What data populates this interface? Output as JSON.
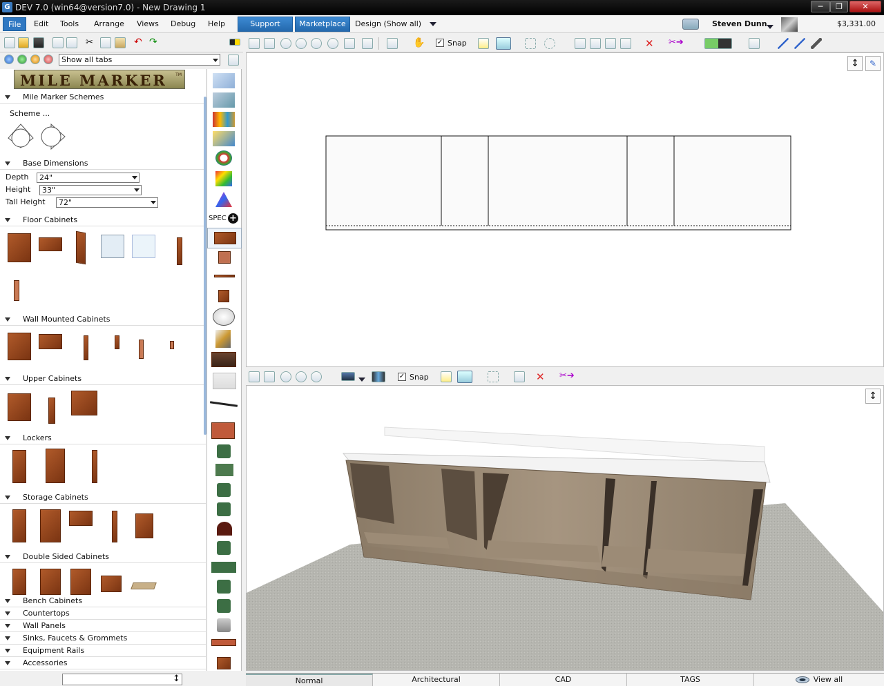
{
  "window": {
    "title": "DEV 7.0 (win64@version7.0) - New Drawing 1",
    "controls": [
      "─",
      "❐",
      "✕"
    ]
  },
  "menubar": {
    "items": [
      "File",
      "Edit",
      "Tools",
      "Arrange",
      "Views",
      "Debug",
      "Help"
    ],
    "support_label": "Support",
    "marketplace_label": "Marketplace",
    "design_label": "Design (Show all)",
    "user_name": "Steven Dunn",
    "balance": "$3,331.00"
  },
  "left_toolbar": {
    "tabs_filter": "Show all tabs"
  },
  "catalog": {
    "logo_text": "MILE MARKER",
    "logo_tm": "TM",
    "schemes_header": "Mile Marker Schemes",
    "scheme_label": "Scheme ...",
    "base_dimensions_header": "Base Dimensions",
    "depth_label": "Depth",
    "depth_value": "24\"",
    "height_label": "Height",
    "height_value": "33\"",
    "tall_height_label": "Tall Height",
    "tall_height_value": "72\"",
    "sections": [
      "Floor Cabinets",
      "Wall Mounted Cabinets",
      "Upper Cabinets",
      "Lockers",
      "Storage Cabinets",
      "Double Sided Cabinets",
      "Bench Cabinets",
      "Countertops",
      "Wall Panels",
      "Sinks, Faucets & Grommets",
      "Equipment Rails",
      "Accessories"
    ]
  },
  "icon_column": {
    "spec_label": "SPEC"
  },
  "toolbar_2d": {
    "snap_label": "Snap"
  },
  "toolbar_3d": {
    "snap_label": "Snap"
  },
  "bottom_tabs": [
    "Normal",
    "Architectural",
    "CAD",
    "TAGS",
    "View all"
  ],
  "colors": {
    "accent": "#2f78c2",
    "wood": "#9a4a20",
    "cabinet_3d": "#a08f7c"
  }
}
